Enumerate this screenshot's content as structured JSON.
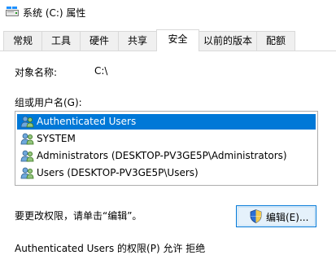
{
  "window": {
    "title": "系统 (C:) 属性"
  },
  "tabs": [
    {
      "label": "常规"
    },
    {
      "label": "工具"
    },
    {
      "label": "硬件"
    },
    {
      "label": "共享"
    },
    {
      "label": "安全",
      "active": true
    },
    {
      "label": "以前的版本"
    },
    {
      "label": "配额"
    }
  ],
  "security": {
    "object_name_label": "对象名称:",
    "object_name_value": "C:\\",
    "groups_label": "组或用户名(G):",
    "users": [
      {
        "name": "Authenticated Users",
        "selected": true
      },
      {
        "name": "SYSTEM"
      },
      {
        "name": "Administrators (DESKTOP-PV3GE5P\\Administrators)"
      },
      {
        "name": "Users (DESKTOP-PV3GE5P\\Users)"
      }
    ],
    "change_hint": "要更改权限，请单击“编辑”。",
    "edit_button_label": "编辑(E)...",
    "permissions_header_partial": "Authenticated Users 的权限(P)                允许         拒绝"
  },
  "colors": {
    "selection": "#0078d7",
    "button_border": "#0078d7",
    "button_bg": "#e5f1fb"
  }
}
